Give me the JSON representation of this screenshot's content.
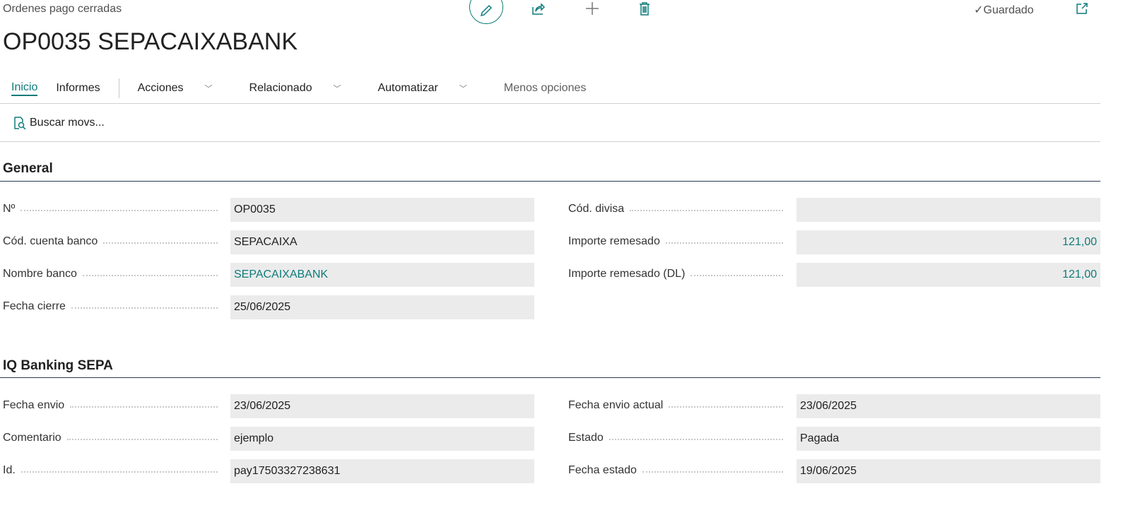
{
  "header": {
    "breadcrumb": "Ordenes pago cerradas",
    "title": "OP0035 SEPACAIXABANK",
    "saved": "Guardado"
  },
  "nav": {
    "tabs": [
      "Inicio",
      "Informes"
    ],
    "menus": [
      "Acciones",
      "Relacionado",
      "Automatizar"
    ],
    "less": "Menos opciones"
  },
  "actions": {
    "buscar": "Buscar movs..."
  },
  "sections": [
    {
      "title": "General",
      "left": [
        {
          "label": "Nº",
          "value": "OP0035"
        },
        {
          "label": "Cód. cuenta banco",
          "value": "SEPACAIXA"
        },
        {
          "label": "Nombre banco",
          "value": "SEPACAIXABANK"
        },
        {
          "label": "Fecha cierre",
          "value": "25/06/2025"
        }
      ],
      "right": [
        {
          "label": "Cód. divisa",
          "value": ""
        },
        {
          "label": "Importe remesado",
          "value": "121,00"
        },
        {
          "label": "Importe remesado (DL)",
          "value": "121,00"
        }
      ]
    },
    {
      "title": "IQ Banking SEPA",
      "left": [
        {
          "label": "Fecha envio",
          "value": "23/06/2025"
        },
        {
          "label": "Comentario",
          "value": "ejemplo"
        },
        {
          "label": "Id.",
          "value": "pay17503327238631"
        }
      ],
      "right": [
        {
          "label": "Fecha envio actual",
          "value": "23/06/2025"
        },
        {
          "label": "Estado",
          "value": "Pagada"
        },
        {
          "label": "Fecha estado",
          "value": "19/06/2025"
        }
      ]
    }
  ],
  "colors": {
    "accent": "#0f7b7b"
  }
}
